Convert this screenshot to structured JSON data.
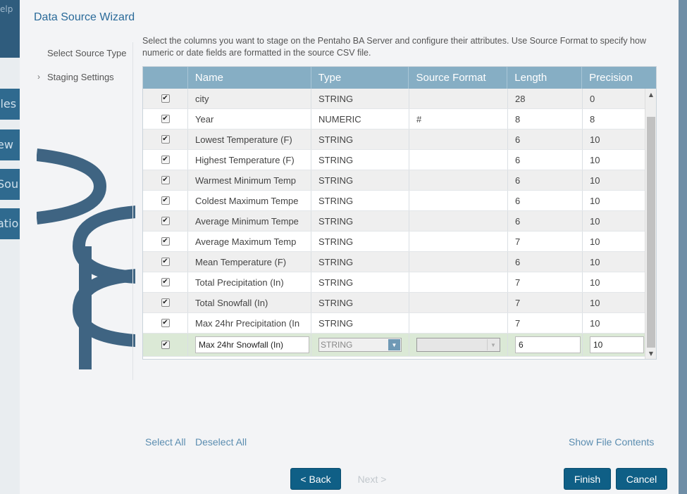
{
  "background": {
    "help_text": "elp",
    "side_buttons": [
      "iles",
      "ew",
      "Sou",
      "atio"
    ]
  },
  "wizard": {
    "title": "Data Source Wizard",
    "steps": [
      {
        "label": "Select Source Type"
      },
      {
        "label": "Staging Settings"
      }
    ],
    "description": "Select the columns you want to stage on the Pentaho BA Server and configure their attributes. Use Source Format to specify how numeric or date fields are formatted in the source CSV file."
  },
  "grid": {
    "headers": [
      "",
      "Name",
      "Type",
      "Source Format",
      "Length",
      "Precision"
    ],
    "rows": [
      {
        "checked": "✔",
        "name": "city",
        "type": "STRING",
        "format": "",
        "length": "28",
        "precision": "0"
      },
      {
        "checked": "✔",
        "name": "Year",
        "type": "NUMERIC",
        "format": "#",
        "length": "8",
        "precision": "8"
      },
      {
        "checked": "✔",
        "name": "Lowest Temperature (F)",
        "type": "STRING",
        "format": "",
        "length": "6",
        "precision": "10"
      },
      {
        "checked": "✔",
        "name": "Highest Temperature (F)",
        "type": "STRING",
        "format": "",
        "length": "6",
        "precision": "10"
      },
      {
        "checked": "✔",
        "name": "Warmest Minimum Temp",
        "type": "STRING",
        "format": "",
        "length": "6",
        "precision": "10"
      },
      {
        "checked": "✔",
        "name": "Coldest Maximum Tempe",
        "type": "STRING",
        "format": "",
        "length": "6",
        "precision": "10"
      },
      {
        "checked": "✔",
        "name": "Average Minimum Tempe",
        "type": "STRING",
        "format": "",
        "length": "6",
        "precision": "10"
      },
      {
        "checked": "✔",
        "name": "Average Maximum Temp",
        "type": "STRING",
        "format": "",
        "length": "7",
        "precision": "10"
      },
      {
        "checked": "✔",
        "name": "Mean Temperature (F)",
        "type": "STRING",
        "format": "",
        "length": "6",
        "precision": "10"
      },
      {
        "checked": "✔",
        "name": "Total Precipitation (In)",
        "type": "STRING",
        "format": "",
        "length": "7",
        "precision": "10"
      },
      {
        "checked": "✔",
        "name": "Total Snowfall (In)",
        "type": "STRING",
        "format": "",
        "length": "7",
        "precision": "10"
      },
      {
        "checked": "✔",
        "name": "Max 24hr Precipitation (In",
        "type": "STRING",
        "format": "",
        "length": "7",
        "precision": "10"
      }
    ],
    "editing_row": {
      "checked": "✔",
      "name": "Max 24hr Snowfall (In)",
      "type": "STRING",
      "format": "",
      "length": "6",
      "precision": "10"
    }
  },
  "actions": {
    "select_all": "Select All",
    "deselect_all": "Deselect All",
    "show_file_contents": "Show File Contents",
    "back": "< Back",
    "next": "Next >",
    "finish": "Finish",
    "cancel": "Cancel"
  },
  "colors": {
    "accent": "#0f5f86",
    "header": "#86aec4",
    "title": "#2a6a99",
    "editing_row": "#dbe9d6"
  }
}
